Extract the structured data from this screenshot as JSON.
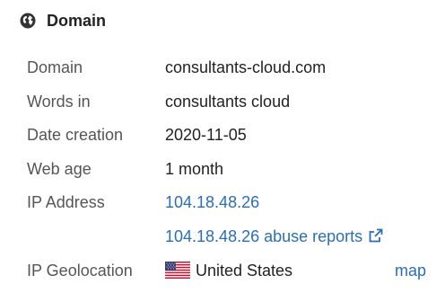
{
  "section": {
    "title": "Domain",
    "icon": "globe-icon"
  },
  "rows": {
    "domain": {
      "label": "Domain",
      "value": "consultants-cloud.com"
    },
    "words": {
      "label": "Words in",
      "value": "consultants cloud"
    },
    "date_creation": {
      "label": "Date creation",
      "value": "2020-11-05"
    },
    "web_age": {
      "label": "Web age",
      "value": "1 month"
    },
    "ip_address": {
      "label": "IP Address",
      "value": "104.18.48.26"
    },
    "abuse_reports": {
      "value": "104.18.48.26 abuse reports",
      "icon": "external-link-icon"
    },
    "ip_geolocation": {
      "label": "IP Geolocation",
      "value": "United States",
      "flag": "us-flag-icon",
      "map_label": "map"
    }
  },
  "colors": {
    "link": "#2a6ebb",
    "label": "#555555",
    "text": "#222222"
  }
}
